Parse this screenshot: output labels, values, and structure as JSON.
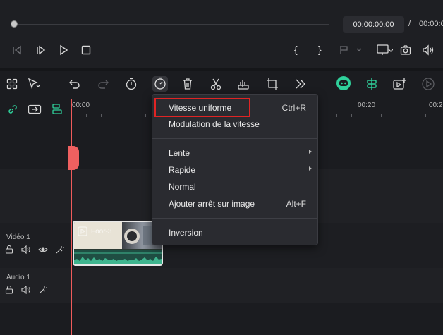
{
  "player": {
    "current_time": "00:00:00:00",
    "separator": "/",
    "total_time": "00:00:00"
  },
  "ruler": {
    "labels": [
      "00:00",
      "00:20",
      "00:2"
    ]
  },
  "tracks": {
    "video_label": "Vidéo 1",
    "audio_label": "Audio 1"
  },
  "clip": {
    "name": "Foor-3"
  },
  "speed_menu": {
    "items": [
      {
        "label": "Vitesse uniforme",
        "shortcut": "Ctrl+R"
      },
      {
        "label": "Modulation de la vitesse",
        "shortcut": ""
      },
      {
        "label": "Lente",
        "shortcut": ""
      },
      {
        "label": "Rapide",
        "shortcut": ""
      },
      {
        "label": "Normal",
        "shortcut": ""
      },
      {
        "label": "Ajouter arrêt sur image",
        "shortcut": "Alt+F"
      },
      {
        "label": "Inversion",
        "shortcut": ""
      }
    ]
  },
  "colors": {
    "playhead": "#ef5b5b",
    "highlight": "#e02424",
    "accent_green": "#2fd19b"
  }
}
